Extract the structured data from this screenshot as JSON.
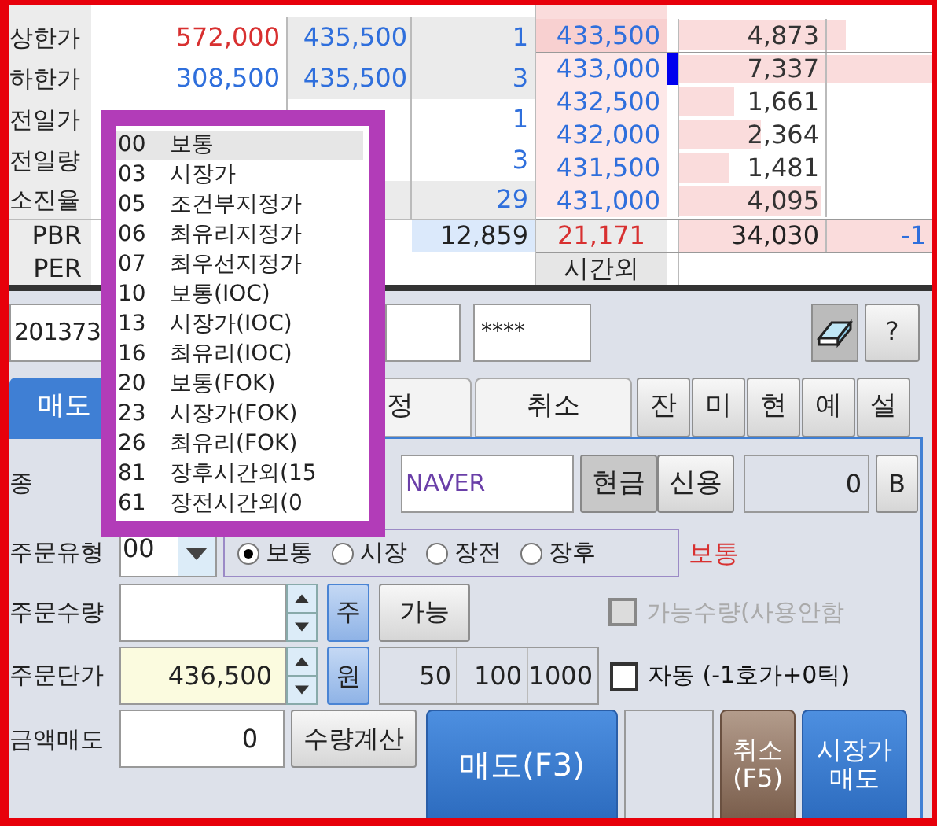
{
  "quote": {
    "rows": [
      {
        "label": "상한가",
        "value": "572,000",
        "color": "#d83030",
        "price": "435,500",
        "count": "1"
      },
      {
        "label": "하한가",
        "value": "308,500",
        "color": "#2f6fdc",
        "price": "435,500",
        "count": "3"
      },
      {
        "label": "전일가",
        "count": "1"
      },
      {
        "label": "전일량",
        "count": "3"
      },
      {
        "label": "소진율",
        "count": "29"
      }
    ],
    "pbr_label": "PBR",
    "per_label": "PER",
    "total": "12,859"
  },
  "orderbook": {
    "levels": [
      {
        "price": "433,500",
        "volume": "4,873",
        "level": 0.66,
        "ask": true,
        "current": false
      },
      {
        "price": "433,000",
        "volume": "7,337",
        "level": 1,
        "ask": false,
        "current": true
      },
      {
        "price": "432,500",
        "volume": "1,661",
        "level": 0.22,
        "ask": false,
        "current": false
      },
      {
        "price": "432,000",
        "volume": "2,364",
        "level": 0.32,
        "ask": false,
        "current": false
      },
      {
        "price": "431,500",
        "volume": "1,481",
        "level": 0.2,
        "ask": false,
        "current": false
      },
      {
        "price": "431,000",
        "volume": "4,095",
        "level": 0.56,
        "ask": false,
        "current": false
      }
    ],
    "price_total": "21,171",
    "volume_total": "34,030",
    "change": "-1",
    "after_hours": "시간외"
  },
  "account": {
    "number": "201373",
    "password": "****",
    "help": "?"
  },
  "tabs": [
    {
      "label": "매도",
      "selected": true
    },
    {
      "label": "정",
      "selected": false
    },
    {
      "label": "취소",
      "selected": false
    }
  ],
  "shortcut_buttons": [
    "잔",
    "미",
    "현",
    "예",
    "설"
  ],
  "form": {
    "stock_label": "종",
    "stock_name": "NAVER",
    "account_types": [
      {
        "label": "현금",
        "selected": true
      },
      {
        "label": "신용",
        "selected": false
      }
    ],
    "qty_display": "0",
    "b_button": "B",
    "order_type": {
      "label": "주문유형",
      "code": "00",
      "options": [
        {
          "label": "보통",
          "selected": true
        },
        {
          "label": "시장",
          "selected": false
        },
        {
          "label": "장전",
          "selected": false
        },
        {
          "label": "장후",
          "selected": false
        }
      ],
      "current": "보통"
    },
    "quantity": {
      "label": "주문수량",
      "unit": "주",
      "possible": "가능",
      "option": {
        "label": "가능수량(사용안함",
        "checked": false,
        "disabled": true
      }
    },
    "price": {
      "label": "주문단가",
      "value": "436,500",
      "unit": "원",
      "ticks": [
        "50",
        "100",
        "1000"
      ],
      "option": {
        "label": "자동 (-1호가+0틱)",
        "checked": false,
        "disabled": false
      }
    },
    "amount": {
      "label": "금액매도",
      "value": "0",
      "calc": "수량계산"
    },
    "actions": [
      {
        "kind": "sell",
        "lines": [
          "매도(F3)"
        ]
      },
      {
        "kind": "blank"
      },
      {
        "kind": "cancel",
        "lines": [
          "취소",
          "(F5)"
        ]
      },
      {
        "kind": "market",
        "lines": [
          "시장가",
          "매도"
        ]
      }
    ]
  },
  "dropdown": {
    "items": [
      {
        "code": "00",
        "name": "보통",
        "selected": true
      },
      {
        "code": "03",
        "name": "시장가",
        "selected": false
      },
      {
        "code": "05",
        "name": "조건부지정가",
        "selected": false
      },
      {
        "code": "06",
        "name": "최유리지정가",
        "selected": false
      },
      {
        "code": "07",
        "name": "최우선지정가",
        "selected": false
      },
      {
        "code": "10",
        "name": "보통(IOC)",
        "selected": false
      },
      {
        "code": "13",
        "name": "시장가(IOC)",
        "selected": false
      },
      {
        "code": "16",
        "name": "최유리(IOC)",
        "selected": false
      },
      {
        "code": "20",
        "name": "보통(FOK)",
        "selected": false
      },
      {
        "code": "23",
        "name": "시장가(FOK)",
        "selected": false
      },
      {
        "code": "26",
        "name": "최유리(FOK)",
        "selected": false
      },
      {
        "code": "81",
        "name": "장후시간외(15",
        "selected": false
      },
      {
        "code": "61",
        "name": "장전시간외(0",
        "selected": false
      }
    ]
  }
}
